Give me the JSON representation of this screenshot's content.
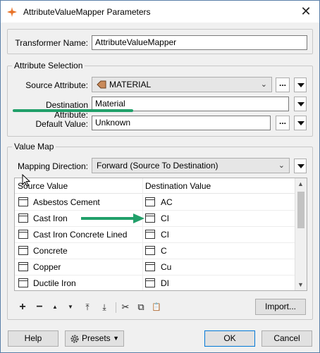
{
  "window": {
    "title": "AttributeValueMapper Parameters",
    "close_glyph": "✕"
  },
  "transformer": {
    "label": "Transformer Name:",
    "value": "AttributeValueMapper"
  },
  "attribute_selection": {
    "title": "Attribute Selection",
    "source_label": "Source Attribute:",
    "source_value": "MATERIAL",
    "destination_label": "Destination Attribute:",
    "destination_value": "Material",
    "default_label": "Default Value:",
    "default_value": "Unknown",
    "ellipsis": "..."
  },
  "value_map": {
    "title": "Value Map",
    "direction_label": "Mapping Direction:",
    "direction_value": "Forward (Source To Destination)",
    "columns": [
      "Source Value",
      "Destination Value"
    ],
    "rows": [
      {
        "source": "Asbestos Cement",
        "destination": "AC"
      },
      {
        "source": "Cast Iron",
        "destination": "CI"
      },
      {
        "source": "Cast Iron Concrete Lined",
        "destination": "CI"
      },
      {
        "source": "Concrete",
        "destination": "C"
      },
      {
        "source": "Copper",
        "destination": "Cu"
      },
      {
        "source": "Ductile Iron",
        "destination": "DI"
      }
    ],
    "import_label": "Import..."
  },
  "toolbar_icons": {
    "add": "+",
    "remove": "−",
    "up": "▲",
    "down": "▼",
    "top": "⤒",
    "bottom": "⤓",
    "cut": "✂",
    "copy": "⧉",
    "paste": "📋"
  },
  "footer": {
    "help": "Help",
    "presets": "Presets",
    "ok": "OK",
    "cancel": "Cancel"
  },
  "colors": {
    "annotation_green": "#21a06a",
    "focus_border": "#0078d7"
  }
}
